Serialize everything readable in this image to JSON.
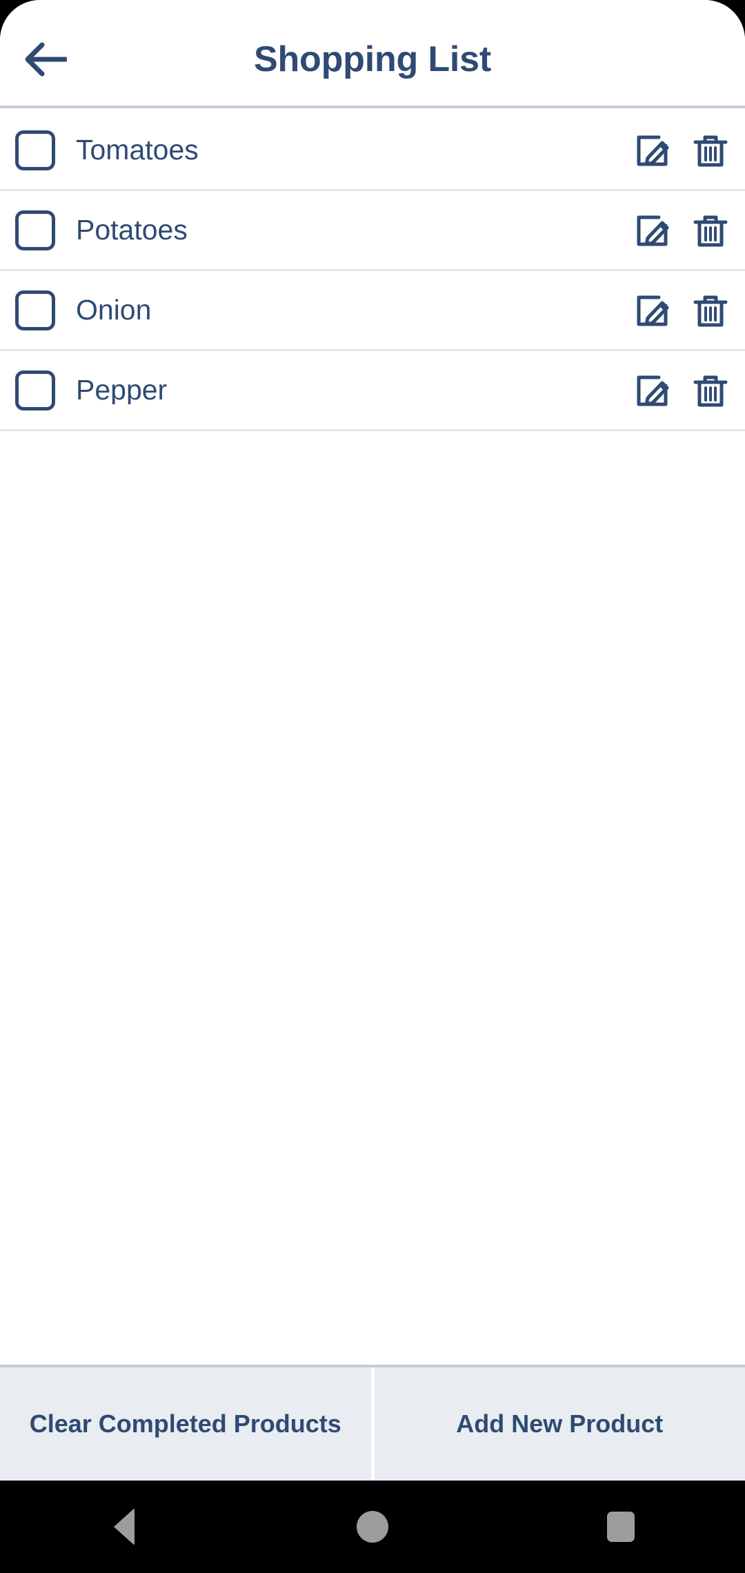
{
  "header": {
    "back_icon": "arrow-left-icon",
    "title": "Shopping List"
  },
  "list": {
    "items": [
      {
        "label": "Tomatoes",
        "checked": false,
        "edit_icon": "edit-square-pencil-icon",
        "delete_icon": "trash-icon"
      },
      {
        "label": "Potatoes",
        "checked": false,
        "edit_icon": "edit-square-pencil-icon",
        "delete_icon": "trash-icon"
      },
      {
        "label": "Onion",
        "checked": false,
        "edit_icon": "edit-square-pencil-icon",
        "delete_icon": "trash-icon"
      },
      {
        "label": "Pepper",
        "checked": false,
        "edit_icon": "edit-square-pencil-icon",
        "delete_icon": "trash-icon"
      }
    ]
  },
  "bottom_bar": {
    "clear_label": "Clear Completed Products",
    "add_label": "Add New Product"
  },
  "nav_bar": {
    "back_icon": "nav-back-triangle-icon",
    "home_icon": "nav-home-circle-icon",
    "recents_icon": "nav-recents-square-icon"
  },
  "colors": {
    "accent_navy": "#2f4a73",
    "divider": "#e3e4e8",
    "header_border": "#c7cbdb",
    "bottom_button_bg": "#e9ecf1",
    "surface": "#ffffff",
    "nav_bar_bg": "#000000",
    "nav_glyph": "#9d9d9d"
  }
}
